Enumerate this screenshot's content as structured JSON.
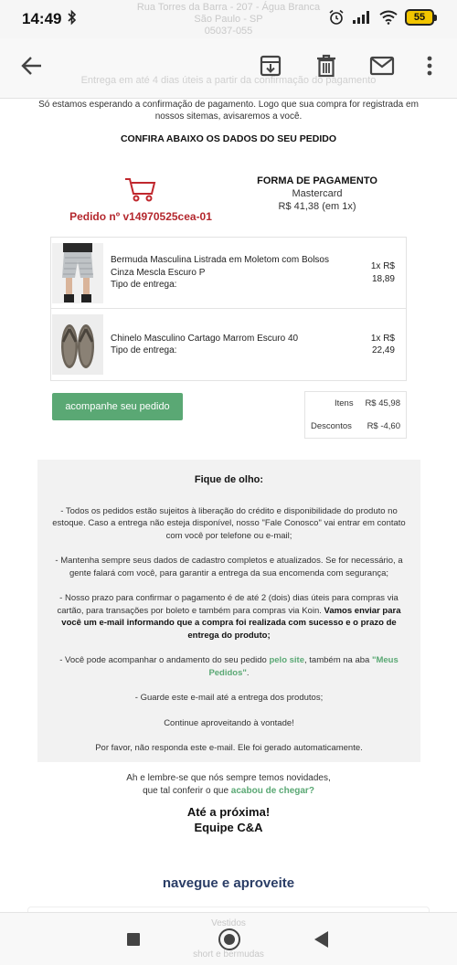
{
  "status_bar": {
    "time": "14:49",
    "battery": "55",
    "icons": [
      "bluetooth-icon",
      "alarm-icon",
      "signal-icon",
      "wifi-icon",
      "battery-icon"
    ]
  },
  "ghost_header": {
    "line1": "Rua Torres da Barra - 207 - Água Branca",
    "line2": "São Paulo - SP",
    "line3": "05037-055",
    "line4": "Entrega em até 4 dias úteis a partir da confirmação do pagamento"
  },
  "app_bar": {
    "icons": [
      "back-arrow-icon",
      "archive-icon",
      "delete-icon",
      "mail-icon",
      "more-vert-icon"
    ]
  },
  "email": {
    "waiting_text": "Só estamos esperando a confirmação de pagamento. Logo que sua compra for registrada em nossos sitemas, avisaremos a você.",
    "confirm_title": "CONFIRA ABAIXO OS DADOS DO SEU PEDIDO",
    "order_number": "Pedido nº v14970525cea-01",
    "payment": {
      "title": "FORMA DE PAGAMENTO",
      "method": "Mastercard",
      "amount": "R$ 41,38 (em 1x)"
    },
    "items": [
      {
        "name": "Bermuda Masculina Listrada em Moletom com Bolsos Cinza Mescla Escuro P",
        "delivery_label": "Tipo de entrega:",
        "qty": "1x R$",
        "price": "18,89"
      },
      {
        "name": "Chinelo Masculino Cartago Marrom Escuro 40",
        "delivery_label": "Tipo de entrega:",
        "qty": "1x R$",
        "price": "22,49"
      }
    ],
    "track_button": "acompanhe seu pedido",
    "totals": [
      {
        "label": "Itens",
        "value": "R$ 45,98"
      },
      {
        "label": "Descontos",
        "value": "R$ -4,60"
      }
    ],
    "notice": {
      "title": "Fique de olho:",
      "p1": "- Todos os pedidos estão sujeitos à liberação do crédito e disponibilidade do produto no estoque. Caso a entrega não esteja disponível, nosso \"Fale Conosco\" vai entrar em contato com você por telefone ou e-mail;",
      "p2": "- Mantenha sempre seus dados de cadastro completos e atualizados. Se for necessário, a gente falará com você, para garantir a entrega da sua encomenda com segurança;",
      "p3_a": "- Nosso prazo para confirmar o pagamento é de até 2 (dois) dias úteis para compras via cartão, para transações por boleto e também para compras via Koin. ",
      "p3_b": "Vamos enviar para você um e-mail informando que a compra foi realizada com sucesso e o prazo de entrega do produto;",
      "p4_a": "- Você pode acompanhar o andamento do seu pedido ",
      "p4_link1": "pelo site",
      "p4_b": ", também na aba ",
      "p4_link2": "\"Meus Pedidos\"",
      "p4_c": ".",
      "p5": "- Guarde este e-mail até a entrega dos produtos;",
      "p6": "Continue aproveitando à vontade!",
      "p7": "Por favor, não responda este e-mail. Ele foi gerado automaticamente."
    },
    "remember_line1": "Ah e lembre-se que nós sempre temos novidades,",
    "remember_line2_a": "que tal conferir o que ",
    "remember_link": "acabou de chegar?",
    "bye_line1": "Até a próxima!",
    "bye_line2": "Equipe C&A",
    "navegue": "navegue e aproveite",
    "ghost_bottom1": "Vestidos",
    "ghost_bottom2": "short e bermudas"
  }
}
